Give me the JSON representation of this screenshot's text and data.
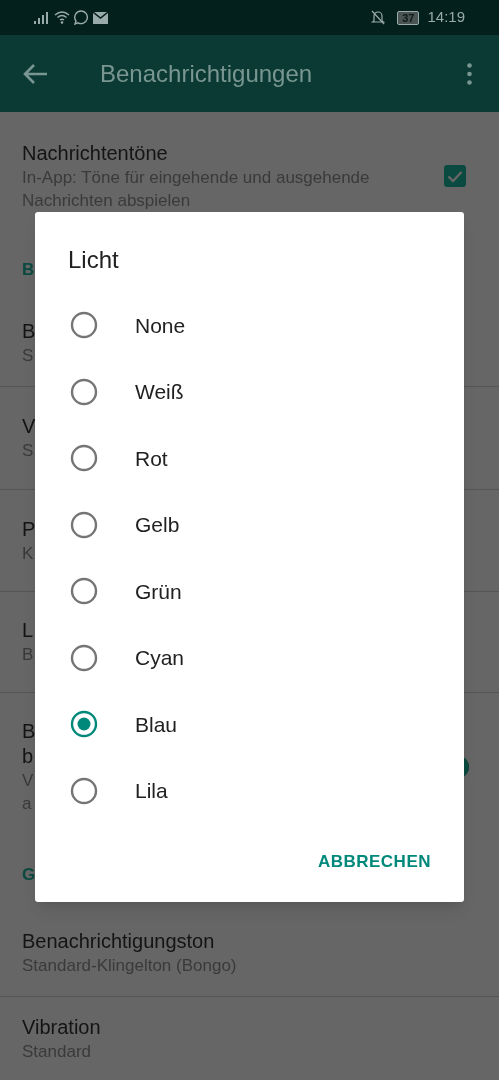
{
  "status_bar": {
    "battery": "37",
    "time": "14:19"
  },
  "app_bar": {
    "title": "Benachrichtigungen"
  },
  "settings": [
    {
      "kind": "setting",
      "title": "Nachrichtentöne",
      "subtitle": "In-App: Töne für eingehende und ausgehende Nachrichten abspielen",
      "control": {
        "kind": "checkbox",
        "checked": true
      }
    },
    {
      "kind": "header",
      "title": "B"
    },
    {
      "kind": "setting",
      "title": "B",
      "subtitle": "S"
    },
    {
      "kind": "setting",
      "title": "V",
      "subtitle": "S"
    },
    {
      "kind": "setting",
      "title": "P",
      "subtitle": "K"
    },
    {
      "kind": "setting",
      "title": "L",
      "subtitle": "B"
    },
    {
      "kind": "setting",
      "title": "B\nb",
      "subtitle": "V\na",
      "control": {
        "kind": "switch",
        "on": true
      }
    },
    {
      "kind": "header",
      "title": "G"
    },
    {
      "kind": "setting",
      "title": "Benachrichtigungston",
      "subtitle": "Standard-Klingelton (Bongo)"
    },
    {
      "kind": "setting",
      "title": "Vibration",
      "subtitle": "Standard"
    }
  ],
  "dialog": {
    "title": "Licht",
    "options": [
      {
        "label": "None",
        "selected": false
      },
      {
        "label": "Weiß",
        "selected": false
      },
      {
        "label": "Rot",
        "selected": false
      },
      {
        "label": "Gelb",
        "selected": false
      },
      {
        "label": "Grün",
        "selected": false
      },
      {
        "label": "Cyan",
        "selected": false
      },
      {
        "label": "Blau",
        "selected": true
      },
      {
        "label": "Lila",
        "selected": false
      }
    ],
    "button": "ABBRECHEN"
  }
}
